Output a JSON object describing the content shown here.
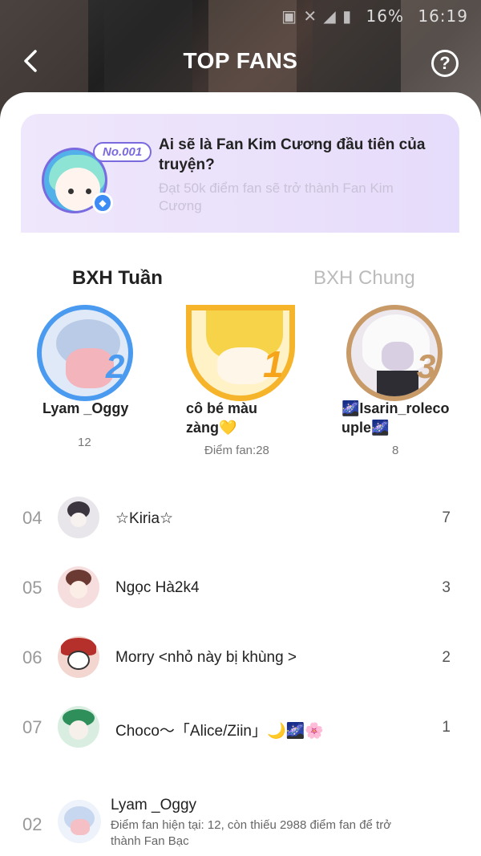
{
  "status_bar": {
    "battery": "16%",
    "time": "16:19"
  },
  "header": {
    "title": "TOP FANS"
  },
  "promo": {
    "badge": "No.001",
    "title": "Ai sẽ là Fan Kim Cương đầu tiên của truyện?",
    "subtitle": "Đạt 50k điểm fan sẽ trở thành Fan Kim Cương"
  },
  "tabs": [
    {
      "label": "BXH Tuần",
      "active": true
    },
    {
      "label": "BXH Chung",
      "active": false
    }
  ],
  "podium": [
    {
      "rank": "2",
      "name": "Lyam _Oggy",
      "score": "12",
      "ring_color": "#4a9bf0"
    },
    {
      "rank": "1",
      "name": "cô bé màu zàng💛",
      "score": "Điểm fan:28",
      "ring_color": "#f6b42a"
    },
    {
      "rank": "3",
      "name": "🌌Isarin_rolecouple🌌",
      "score": "8",
      "ring_color": "#c89a68"
    }
  ],
  "ranking": [
    {
      "num": "04",
      "name": "☆Kiria☆",
      "points": "7"
    },
    {
      "num": "05",
      "name": "Ngọc Hà2k4",
      "points": "3"
    },
    {
      "num": "06",
      "name": "Morry <nhỏ này bị khùng >",
      "points": "2"
    },
    {
      "num": "07",
      "name": "Choco～「Alice/Ziin」🌙🌌🌸",
      "points": "1"
    }
  ],
  "current_user": {
    "num": "02",
    "name": "Lyam _Oggy",
    "desc": "Điểm fan hiện tại: 12, còn thiếu 2988 điểm fan để trở thành Fan Bạc"
  }
}
